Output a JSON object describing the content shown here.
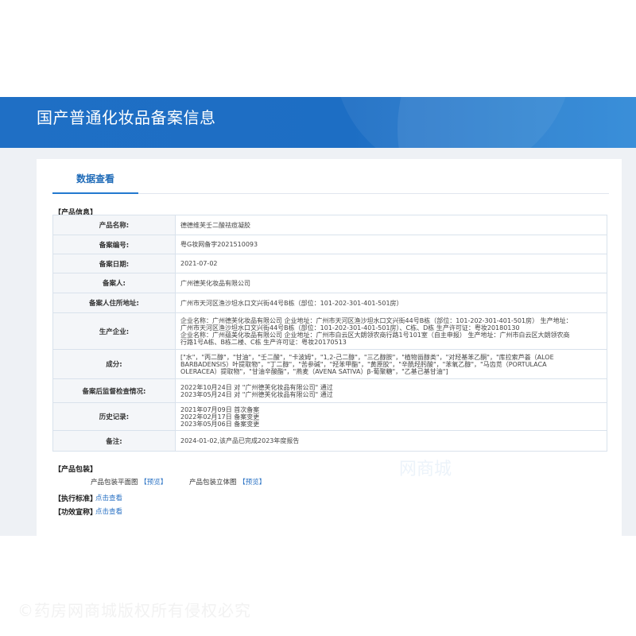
{
  "page": {
    "title": "国产普通化妆品备案信息",
    "tab_label": "数据查看",
    "watermark": "©药房网商城版权所有侵权必究",
    "faint_watermark": "网商城"
  },
  "product_section": {
    "label": "【产品信息】",
    "rows": [
      {
        "key": "产品名称:",
        "lines": [
          "德德维芙壬二酸祛痘凝胶"
        ]
      },
      {
        "key": "备案编号:",
        "lines": [
          "粤G妆网备字2021510093"
        ]
      },
      {
        "key": "备案日期:",
        "lines": [
          "2021-07-02"
        ]
      },
      {
        "key": "备案人:",
        "lines": [
          "广州德芙化妆品有限公司"
        ]
      },
      {
        "key": "备案人住所地址:",
        "lines": [
          "广州市天河区渔沙坦水口文兴街44号B栋（部位：101-202-301-401-501房）"
        ]
      },
      {
        "key": "生产企业:",
        "lines": [
          "企业名称：广州德芙化妆品有限公司 企业地址：广州市天河区渔沙坦水口文兴街44号B栋（部位：101-202-301-401-501房） 生产地址：",
          "广州市天河区渔沙坦水口文兴街44号B栋（部位：101-202-301-401-501房）、C栋、D栋 生产许可证：粤妆20180130",
          "企业名称：广州蕴美化妆品有限公司 企业地址：广州市白云区大朗领农商行路1号101室（自主申报） 生产地址：广州市白云区大朗领农商",
          "行路1号A栋、B栋二楼、C栋 生产许可证：粤妆20170513"
        ]
      },
      {
        "key": "成分:",
        "lines": [
          "[\"水\"，\"丙二醇\"，\"甘油\"，\"壬二酸\"，\"卡波姆\"，\"1,2-己二醇\"，\"三乙醇胺\"，\"植物甾醇类\"，\"对羟基苯乙酮\"，\"库拉索芦荟（ALOE",
          "BARBADENSIS）叶提取物\"，\"丁二醇\"，\"苦参碱\"，\"羟苯甲酯\"，\"黄原胶\"，\"辛酰羟肟酸\"，\"苯氧乙醇\"，\"马齿苋（PORTULACA",
          "OLERACEA）提取物\"，\"甘油辛酸酯\"，\"燕麦（AVENA SATIVA）β-葡聚糖\"，\"乙基己基甘油\"]"
        ]
      },
      {
        "key": "备案后监督检查情况:",
        "lines": [
          "2022年10月24日 对 \"广州德芙化妆品有限公司\" 通过",
          "2023年05月24日 对 \"广州德芙化妆品有限公司\" 通过"
        ]
      },
      {
        "key": "历史记录:",
        "lines": [
          "2021年07月09日 首次备案",
          "2022年02月17日 备案变更",
          "2023年05月06日 备案变更"
        ]
      },
      {
        "key": "备注:",
        "lines": [
          "2024-01-02,该产品已完成2023年度报告"
        ]
      }
    ]
  },
  "package_section": {
    "label": "【产品包装】",
    "items": [
      {
        "label": "产品包装平面图",
        "link": "【预览】"
      },
      {
        "label": "产品包装立体图",
        "link": "【预览】"
      }
    ]
  },
  "standard": {
    "label": "【执行标准】",
    "link": "点击查看"
  },
  "claims": {
    "label": "【功效宣称】",
    "link": "点击查看"
  }
}
